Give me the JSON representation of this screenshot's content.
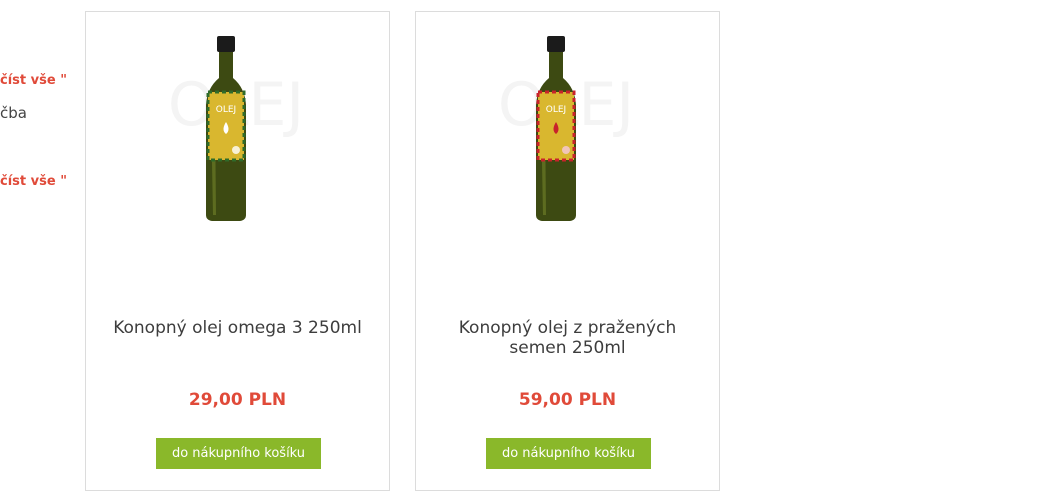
{
  "sidebar": {
    "read_more_1": "číst vše \"",
    "text_fragment": "čba",
    "read_more_2": "číst vše \""
  },
  "products": [
    {
      "name": "Konopný olej omega 3 250ml",
      "price": "29,00 PLN",
      "button_label": "do nákupního košíku",
      "label_word": "OLEJ",
      "label_color": "#d4a52c",
      "accent_color": "#2f6b2a"
    },
    {
      "name": "Konopný olej z pražených semen 250ml",
      "price": "59,00 PLN",
      "button_label": "do nákupního košíku",
      "label_word": "OLEJ",
      "label_color": "#d4a52c",
      "accent_color": "#c8222b"
    }
  ],
  "colors": {
    "accent_red": "#e04a39",
    "button_green": "#8ab82a"
  }
}
